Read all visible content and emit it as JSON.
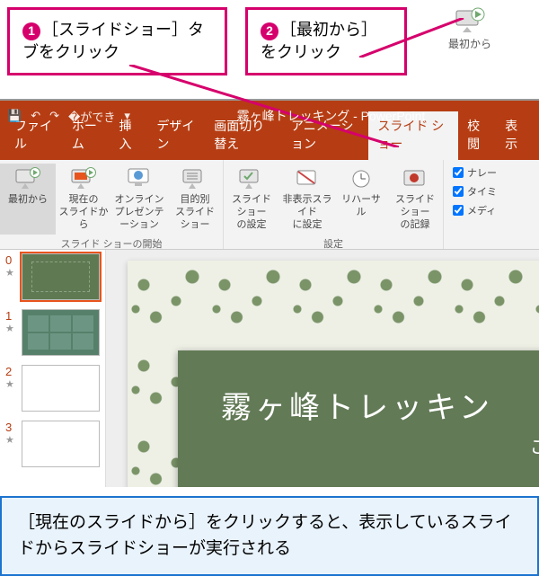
{
  "callouts": {
    "c1": {
      "num": "1",
      "text": "［スライドショー］タブをクリック"
    },
    "c2": {
      "num": "2",
      "text": "［最初から］をクリック"
    }
  },
  "top_icon_label": "最初から",
  "titlebar": {
    "doc": "霧ヶ峰トレッキング",
    "app": "PowerPoint"
  },
  "tabs": {
    "file": "ファイル",
    "home": "ホーム",
    "insert": "挿入",
    "design": "デザイン",
    "transitions": "画面切り替え",
    "animations": "アニメーション",
    "slideshow": "スライド ショー",
    "review": "校閲",
    "view": "表示"
  },
  "ribbon": {
    "from_beginning": "最初から",
    "from_current": "現在の\nスライドから",
    "online": "オンライン\nプレゼンテーション",
    "custom": "目的別\nスライド ショー",
    "group_start": "スライド ショーの開始",
    "setup": "スライド ショー\nの設定",
    "hide": "非表示スライド\nに設定",
    "rehearse": "リハーサル",
    "record": "スライド ショー\nの記録",
    "group_setup": "設定",
    "chk_narration": "ナレー",
    "chk_timing": "タイミ",
    "chk_media": "メディ"
  },
  "thumbs": [
    "0",
    "1",
    "2",
    "3"
  ],
  "slide": {
    "title": "霧ヶ峰トレッキン",
    "subtitle": "ご案内"
  },
  "footer": "［現在のスライドから］をクリックすると、表示しているスライドからスライドショーが実行される"
}
